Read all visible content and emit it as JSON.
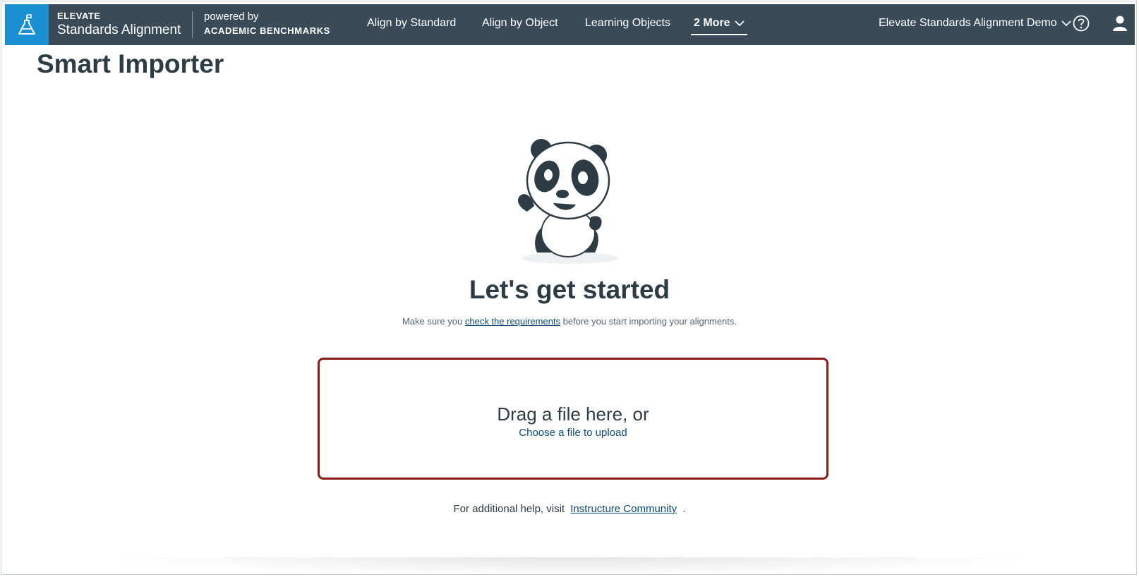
{
  "header": {
    "brand_eyebrow": "ELEVATE",
    "brand_product": "Standards Alignment",
    "powered_by": "powered by",
    "partner": "ACADEMIC BENCHMARKS",
    "nav": [
      {
        "label": "Align by Standard"
      },
      {
        "label": "Align by Object"
      },
      {
        "label": "Learning Objects"
      },
      {
        "label": "2 More"
      }
    ],
    "account_label": "Elevate Standards Alignment Demo",
    "icons": {
      "logo": "flag-flask-icon",
      "help": "help-circle-icon",
      "user": "user-icon",
      "chevron": "chevron-down-icon"
    }
  },
  "page": {
    "title": "Smart Importer",
    "hero_title": "Let's get started",
    "subtext_before": "Make sure you",
    "subtext_link": "check the requirements",
    "subtext_after": "before you start importing your alignments.",
    "dropzone_main": "Drag a file here, or",
    "dropzone_link": "Choose a file to upload",
    "help_before": "For additional help, visit",
    "help_link": "Instructure Community",
    "help_after": "."
  },
  "colors": {
    "topbar": "#394b58",
    "logo_bg": "#1a8fd1",
    "dropzone_border": "#8b1a1a",
    "link": "#0b4a7e"
  }
}
